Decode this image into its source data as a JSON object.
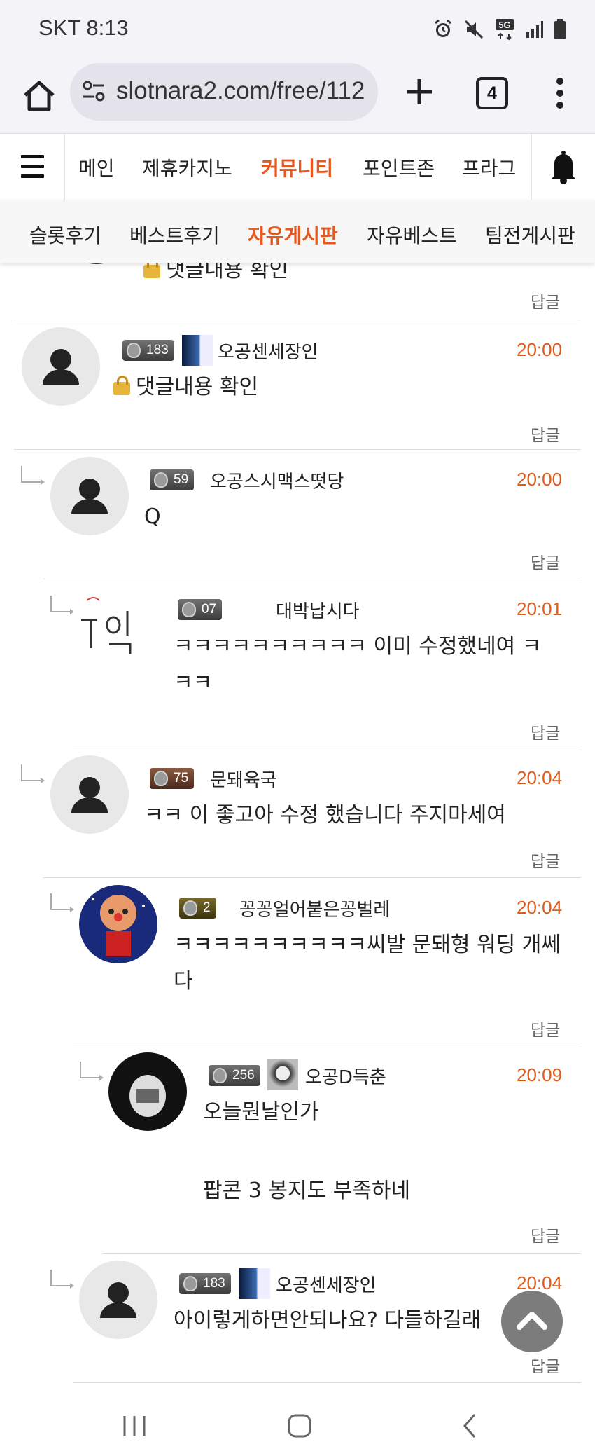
{
  "status_bar": {
    "carrier_time": "SKT 8:13",
    "icons": [
      "alarm-icon",
      "mute-icon",
      "5g-icon",
      "signal-icon",
      "battery-icon"
    ],
    "network": "5G"
  },
  "browser": {
    "url": "slotnara2.com/free/112",
    "tab_count": "4"
  },
  "site_nav": {
    "items": [
      "메인",
      "제휴카지노",
      "커뮤니티",
      "포인트존",
      "프라그"
    ],
    "active": "커뮤니티"
  },
  "sub_nav": {
    "items": [
      "슬롯후기",
      "베스트후기",
      "자유게시판",
      "자유베스트",
      "팀전게시판"
    ],
    "active": "자유게시판"
  },
  "colors": {
    "accent": "#e8571e",
    "time": "#e05a18"
  },
  "comments": [
    {
      "text": "댓글내용 확인",
      "locked": true,
      "reply_label": "답글"
    },
    {
      "level": "183",
      "nickname": "오공센세장인",
      "time": "20:00",
      "text": "댓글내용 확인",
      "locked": true,
      "reply_label": "답글"
    },
    {
      "level": "59",
      "nickname": "오공스시맥스떳당",
      "time": "20:00",
      "text": "Q",
      "reply_label": "답글"
    },
    {
      "level": "07",
      "nickname": "대박납시다",
      "time": "20:01",
      "text": "ㅋㅋㅋㅋㅋㅋㅋㅋㅋㅋ 이미 수정했네여 ㅋㅋㅋ",
      "reply_label": "답글"
    },
    {
      "level": "75",
      "nickname": "문돼육국",
      "time": "20:04",
      "text": "ㅋㅋ 이 좋고아 수정 했습니다 주지마세여",
      "reply_label": "답글"
    },
    {
      "level": "2",
      "nickname": "꽁꽁얼어붙은꽁벌레",
      "time": "20:04",
      "text": "ㅋㅋㅋㅋㅋㅋㅋㅋㅋㅋ씨발 문돼형 워딩 개쎄다",
      "reply_label": "답글"
    },
    {
      "level": "256",
      "nickname": "오공D득춘",
      "time": "20:09",
      "text": "오늘뭔날인가",
      "text2": "팝콘 3 봉지도 부족하네",
      "reply_label": "답글"
    },
    {
      "level": "183",
      "nickname": "오공센세장인",
      "time": "20:04",
      "text": "아이렇게하면안되나요? 다들하길래",
      "reply_label": "답글"
    }
  ]
}
